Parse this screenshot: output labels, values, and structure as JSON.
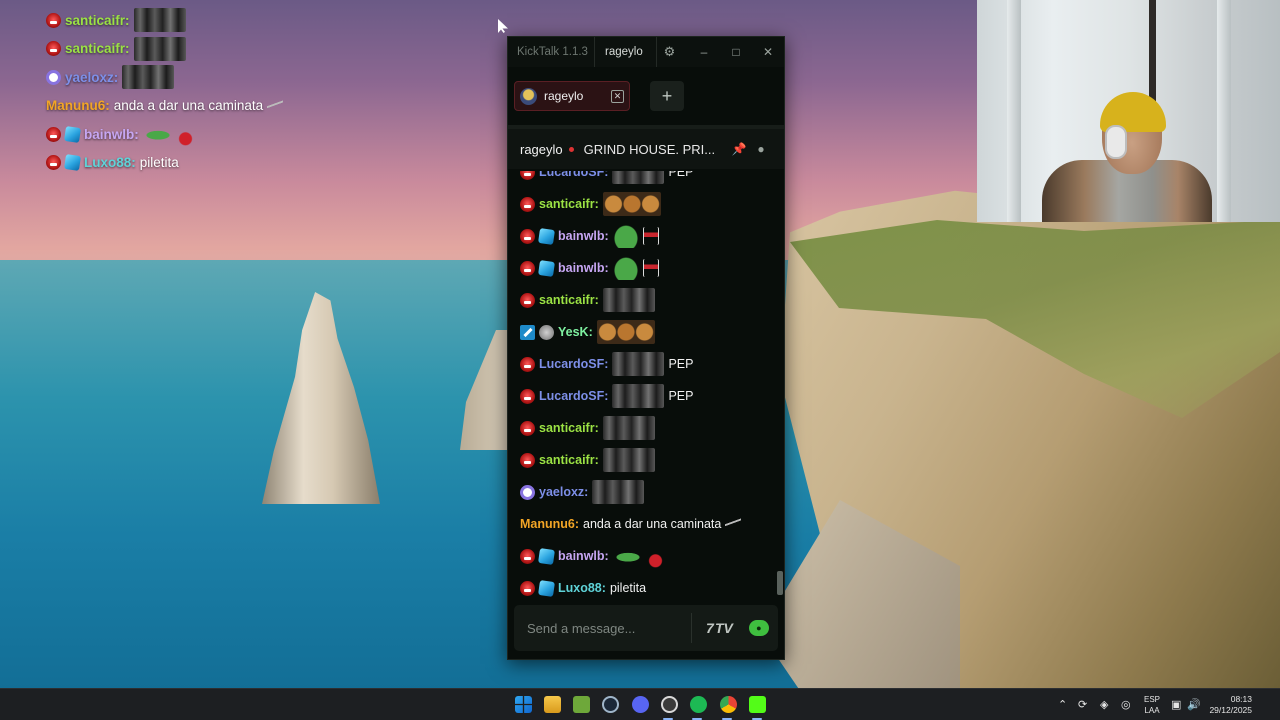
{
  "colors": {
    "kick_green": "#53fc18",
    "window_bg": "#080d0a",
    "tab_active_bg": "#2b1214"
  },
  "overlay": {
    "messages": [
      {
        "badges": [
          "skull"
        ],
        "user": "santicaifr",
        "color": "#9be244",
        "text": "",
        "emotes": [
          "men"
        ]
      },
      {
        "badges": [
          "skull"
        ],
        "user": "santicaifr",
        "color": "#9be244",
        "text": "",
        "emotes": [
          "men"
        ]
      },
      {
        "badges": [
          "ring"
        ],
        "user": "yaeloxz",
        "color": "#7d8fe8",
        "text": "",
        "emotes": [
          "men"
        ]
      },
      {
        "badges": [],
        "user": "Manunu6",
        "color": "#f2a526",
        "text": "anda a dar una caminata",
        "emotes": [
          "walk"
        ]
      },
      {
        "badges": [
          "skull",
          "cube"
        ],
        "user": "bainwlb",
        "color": "#c6a6f2",
        "text": "",
        "emotes": [
          "pepe-red"
        ]
      },
      {
        "badges": [
          "skull",
          "cube"
        ],
        "user": "Luxo88",
        "color": "#5fd3d8",
        "text": "piletita",
        "emotes": []
      }
    ]
  },
  "kicktalk": {
    "app_name": "KickTalk 1.1.3",
    "current_user": "rageylo",
    "icons": {
      "settings": "gear-icon",
      "minimize": "minimize-icon",
      "maximize": "maximize-icon",
      "close": "close-icon"
    },
    "tabs": [
      {
        "label": "rageylo",
        "active": true
      }
    ],
    "add_tab_label": "+",
    "channel": {
      "name": "rageylo",
      "title": "GRIND HOUSE. PRI...",
      "icons": [
        "pin-icon",
        "user-icon"
      ]
    },
    "messages": [
      {
        "badges": [
          "skull"
        ],
        "user": "LucardoSF",
        "color": "#7d8fe8",
        "text": "PEP",
        "emotes": [
          "men"
        ]
      },
      {
        "badges": [
          "skull"
        ],
        "user": "santicaifr",
        "color": "#9be244",
        "text": "",
        "emotes": [
          "monkeys"
        ]
      },
      {
        "badges": [
          "skull",
          "cube"
        ],
        "user": "bainwlb",
        "color": "#c6a6f2",
        "text": "",
        "emotes": [
          "pepe",
          "glass"
        ]
      },
      {
        "badges": [
          "skull",
          "cube"
        ],
        "user": "bainwlb",
        "color": "#c6a6f2",
        "text": "",
        "emotes": [
          "pepe",
          "glass"
        ]
      },
      {
        "badges": [
          "skull"
        ],
        "user": "santicaifr",
        "color": "#9be244",
        "text": "",
        "emotes": [
          "men"
        ]
      },
      {
        "badges": [
          "hammer",
          "grey"
        ],
        "user": "YesK",
        "color": "#7ef0a0",
        "text": "",
        "emotes": [
          "monkeys"
        ]
      },
      {
        "badges": [
          "skull"
        ],
        "user": "LucardoSF",
        "color": "#7d8fe8",
        "text": "PEP",
        "emotes": [
          "men"
        ]
      },
      {
        "badges": [
          "skull"
        ],
        "user": "LucardoSF",
        "color": "#7d8fe8",
        "text": "PEP",
        "emotes": [
          "men"
        ]
      },
      {
        "badges": [
          "skull"
        ],
        "user": "santicaifr",
        "color": "#9be244",
        "text": "",
        "emotes": [
          "men"
        ]
      },
      {
        "badges": [
          "skull"
        ],
        "user": "santicaifr",
        "color": "#9be244",
        "text": "",
        "emotes": [
          "men"
        ]
      },
      {
        "badges": [
          "ring"
        ],
        "user": "yaeloxz",
        "color": "#7d8fe8",
        "text": "",
        "emotes": [
          "men"
        ]
      },
      {
        "badges": [],
        "user": "Manunu6",
        "color": "#f2a526",
        "text": "anda a dar una caminata",
        "emotes": [
          "walk"
        ]
      },
      {
        "badges": [
          "skull",
          "cube"
        ],
        "user": "bainwlb",
        "color": "#c6a6f2",
        "text": "",
        "emotes": [
          "pepe-red"
        ]
      },
      {
        "badges": [
          "skull",
          "cube"
        ],
        "user": "Luxo88",
        "color": "#5fd3d8",
        "text": "piletita",
        "emotes": []
      }
    ],
    "input": {
      "placeholder": "Send a message...",
      "emote_icon": "emote-picker-icon",
      "send_icon": "kick-send-icon"
    }
  },
  "taskbar": {
    "apps": [
      "windows-start-icon",
      "file-explorer-icon",
      "app-green-icon",
      "steam-icon",
      "discord-icon",
      "obs-icon",
      "spotify-icon",
      "chrome-icon",
      "kick-icon"
    ],
    "tray": {
      "language_top": "ESP",
      "language_bottom": "LAA",
      "time": "08:13",
      "date": "29/12/2025"
    }
  }
}
